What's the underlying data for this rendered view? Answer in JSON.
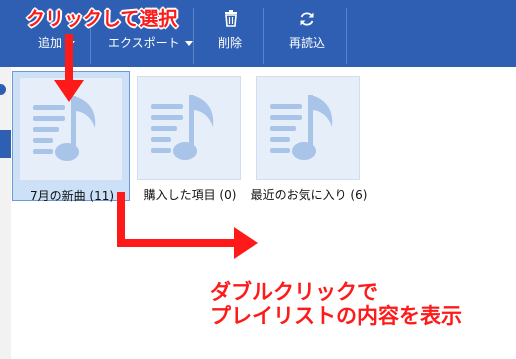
{
  "toolbar": {
    "add_label": "追加",
    "export_label": "エクスポート",
    "delete_label": "削除",
    "reload_label": "再読込"
  },
  "playlists": [
    {
      "name": "7月の新曲 (11)",
      "selected": true
    },
    {
      "name": "購入した項目 (0)",
      "selected": false
    },
    {
      "name": "最近のお気に入り (6)",
      "selected": false
    }
  ],
  "annotations": {
    "click_select": "クリックして選択",
    "double_click_line1": "ダブルクリックで",
    "double_click_line2": "プレイリストの内容を表示"
  },
  "colors": {
    "toolbar": "#2f5fb3",
    "selection": "#cce0f7",
    "annotation": "#ff1a1a",
    "note_icon": "#a9c4e9"
  },
  "icons": {
    "delete": "trash-icon",
    "reload": "refresh-icon",
    "playlist": "music-playlist-icon"
  }
}
